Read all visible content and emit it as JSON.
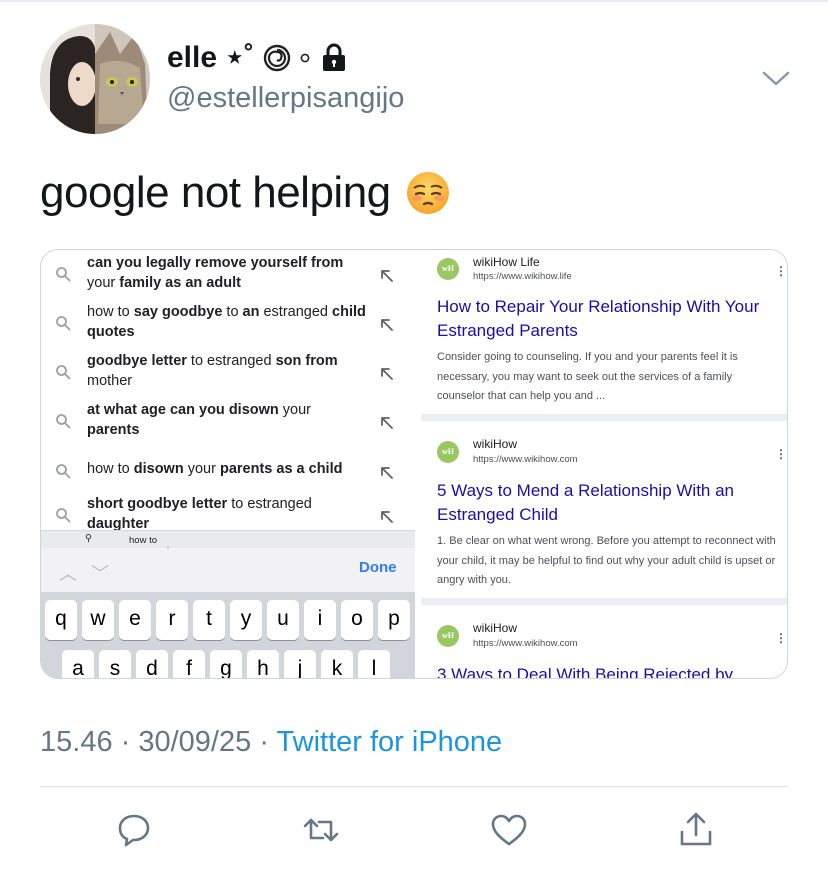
{
  "author": {
    "display_name": "elle ⋆˚",
    "handle": "@estellerpisangijo"
  },
  "tweet": {
    "text": "google not helping"
  },
  "screenshot_left": {
    "suggestions": [
      {
        "html_parts": [
          [
            "b",
            "can you legally remove yourself from "
          ],
          [
            "n",
            "your "
          ],
          [
            "b",
            "family as an adult"
          ]
        ]
      },
      {
        "html_parts": [
          [
            "n",
            "how to "
          ],
          [
            "b",
            "say goodbye"
          ],
          [
            "n",
            " to "
          ],
          [
            "b",
            "an"
          ],
          [
            "n",
            " estranged "
          ],
          [
            "b",
            "child quotes"
          ]
        ]
      },
      {
        "html_parts": [
          [
            "b",
            "goodbye letter"
          ],
          [
            "n",
            " to estranged "
          ],
          [
            "b",
            "son from "
          ],
          [
            "n",
            "mother"
          ]
        ]
      },
      {
        "html_parts": [
          [
            "b",
            "at what age can you disown"
          ],
          [
            "n",
            " your "
          ],
          [
            "b",
            "parents"
          ]
        ]
      },
      {
        "html_parts": [
          [
            "n",
            "how to "
          ],
          [
            "b",
            "disown"
          ],
          [
            "n",
            " your "
          ],
          [
            "b",
            "parents as a child"
          ]
        ]
      },
      {
        "html_parts": [
          [
            "b",
            "short goodbye letter"
          ],
          [
            "n",
            " to estranged "
          ],
          [
            "b",
            "daughter"
          ]
        ]
      }
    ],
    "query_bar": "how to get out of meeting your estranged mother wikihow",
    "done_label": "Done",
    "keys_row1": [
      "q",
      "w",
      "e",
      "r",
      "t",
      "y",
      "u",
      "i",
      "o",
      "p"
    ],
    "keys_row2": [
      "a",
      "s",
      "d",
      "f",
      "g",
      "h",
      "j",
      "k",
      "l"
    ]
  },
  "screenshot_right": {
    "results": [
      {
        "site": "wikiHow Life",
        "url": "https://www.wikihow.life",
        "title": "How to Repair Your Relationship With Your Estranged Parents",
        "snippet": "Consider going to counseling. If you and your parents feel it is necessary, you may want to seek out the services of a family counselor that can help you and ..."
      },
      {
        "site": "wikiHow",
        "url": "https://www.wikihow.com",
        "title": "5 Ways to Mend a Relationship With an Estranged Child",
        "snippet": "1. Be clear on what went wrong. Before you attempt to reconnect with your child, it may be helpful to find out why your adult child is upset or angry with you."
      },
      {
        "site": "wikiHow",
        "url": "https://www.wikihow.com",
        "title": "3 Ways to Deal With Being Rejected by",
        "snippet": ""
      }
    ]
  },
  "meta": {
    "time": "15.46",
    "date": "30/09/25",
    "source": "Twitter for iPhone"
  },
  "icons": {
    "reply": "reply-icon",
    "retweet": "retweet-icon",
    "like": "like-icon",
    "share": "share-icon"
  },
  "colors": {
    "link_blue": "#1b95e0",
    "google_title": "#1a0dab",
    "meta_gray": "#657786"
  }
}
